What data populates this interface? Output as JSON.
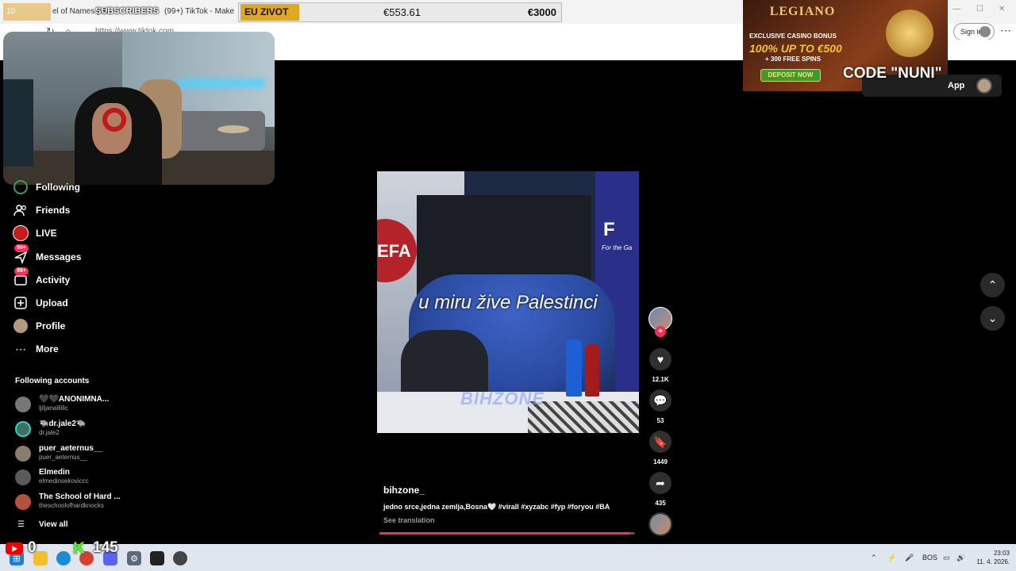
{
  "browser": {
    "tabs": [
      {
        "label": "el of Names | Ra"
      },
      {
        "label": "(99+) TikTok - Make Your"
      }
    ],
    "url": "https://www.tiktok.com",
    "signin_label": "Sign in"
  },
  "overlay": {
    "subscribers_count": "10",
    "subscribers_label": "SUBSCRIBERS",
    "donation_label": "EU ZIVOT",
    "donation_current": "€553.61",
    "donation_goal": "€3000",
    "youtube_count": "0",
    "kick_logo": "K",
    "kick_count": "145",
    "promo_code": "CODE \"NUNI\""
  },
  "ad": {
    "brand": "LEGIANO",
    "line1": "EXCLUSIVE CASINO BONUS",
    "line2": "100% UP TO €500",
    "line3": "+ 300 FREE SPINS",
    "button": "DEPOSIT NOW"
  },
  "header": {
    "app_label": "App"
  },
  "sidebar": {
    "items": [
      {
        "label": "Following",
        "icon": "following-icon"
      },
      {
        "label": "Friends",
        "icon": "friends-icon"
      },
      {
        "label": "LIVE",
        "icon": "live-icon"
      },
      {
        "label": "Messages",
        "icon": "messages-icon",
        "badge": "99+"
      },
      {
        "label": "Activity",
        "icon": "activity-icon",
        "badge": "99+"
      },
      {
        "label": "Upload",
        "icon": "upload-icon"
      },
      {
        "label": "Profile",
        "icon": "profile-avatar"
      },
      {
        "label": "More",
        "icon": "more-icon"
      }
    ],
    "following_title": "Following accounts",
    "accounts": [
      {
        "name": "🖤🖤ANONIMNA...",
        "handle": "ljiljanalililic"
      },
      {
        "name": "🐃dr.jale2🐃",
        "handle": "dr.jale2"
      },
      {
        "name": "puer_aeternus__",
        "handle": "puer_aeternus__"
      },
      {
        "name": "Elmedin",
        "handle": "elmedinsekoviccc"
      },
      {
        "name": "The School of Hard ...",
        "handle": "theschoolofhardknocks"
      }
    ],
    "view_all": "View all"
  },
  "video": {
    "caption_overlay": "u miru žive Palestinci",
    "watermark": "BIHZONE",
    "bg_text_left": "EFA",
    "bg_text_right": "F",
    "bg_text_right_sub": "For the Ga",
    "author": "bihzone_",
    "description": "jedno srce,jedna zemlja,Bosna🤍 #virall #xyzabc #fyp #foryou #BA",
    "see_translation": "See translation",
    "progress": 0.98
  },
  "actions": {
    "likes": "12.1K",
    "comments": "53",
    "saves": "1449",
    "shares": "435"
  },
  "taskbar": {
    "lang": "BOS",
    "time": "23:03",
    "date": "11. 4. 2026."
  },
  "colors": {
    "accent": "#fe2c55",
    "donation_accent": "#e0a820"
  }
}
